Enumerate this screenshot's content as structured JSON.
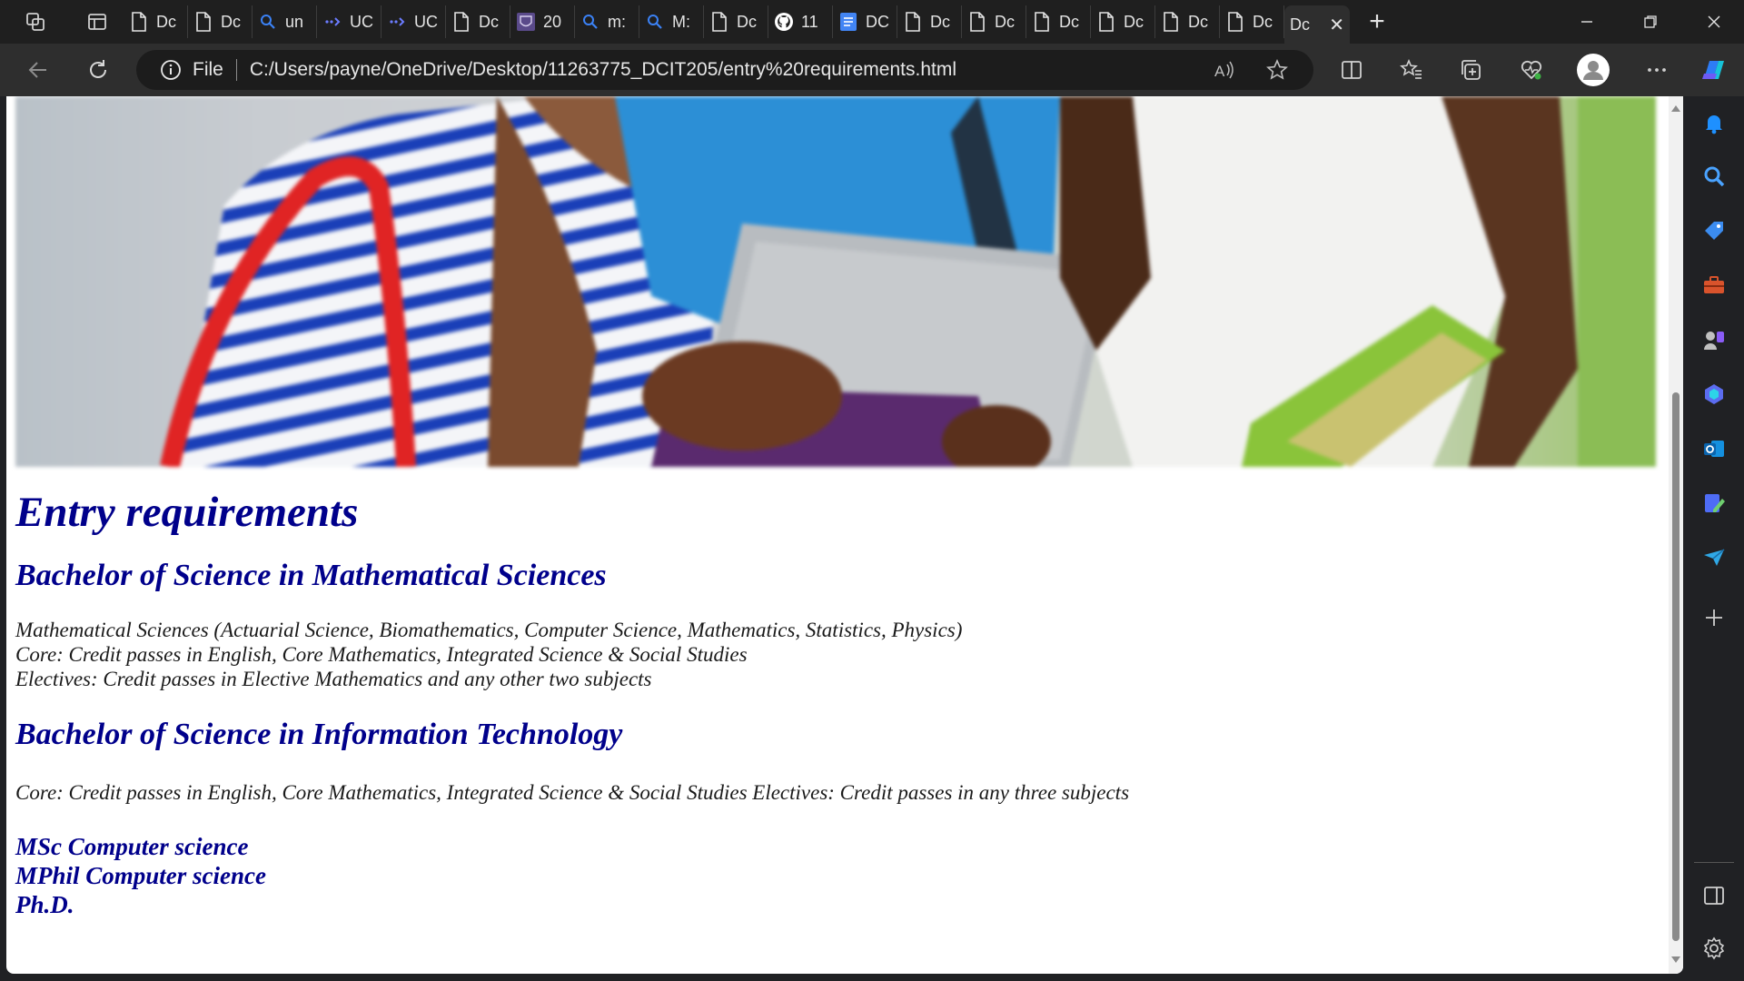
{
  "tabs": [
    {
      "label": "Dc",
      "icon": "document-icon"
    },
    {
      "label": "Dc",
      "icon": "document-icon"
    },
    {
      "label": "un",
      "icon": "search-icon"
    },
    {
      "label": "UC",
      "icon": "arrow-link-icon"
    },
    {
      "label": "UC",
      "icon": "arrow-link-icon"
    },
    {
      "label": "Dc",
      "icon": "document-icon"
    },
    {
      "label": "20",
      "icon": "crest-icon"
    },
    {
      "label": "m:",
      "icon": "search-icon"
    },
    {
      "label": "M:",
      "icon": "search-icon"
    },
    {
      "label": "Dc",
      "icon": "document-icon"
    },
    {
      "label": "11",
      "icon": "github-icon"
    },
    {
      "label": "DC",
      "icon": "docs-icon"
    },
    {
      "label": "Dc",
      "icon": "document-icon"
    },
    {
      "label": "Dc",
      "icon": "document-icon"
    },
    {
      "label": "Dc",
      "icon": "document-icon"
    },
    {
      "label": "Dc",
      "icon": "document-icon"
    },
    {
      "label": "Dc",
      "icon": "document-icon"
    },
    {
      "label": "Dc",
      "icon": "document-icon"
    }
  ],
  "active_tab": {
    "label": "Dc"
  },
  "address_bar": {
    "scheme_label": "File",
    "url": "C:/Users/payne/OneDrive/Desktop/11263775_DCIT205/entry%20requirements.html"
  },
  "page": {
    "title": "Entry requirements",
    "programs": [
      {
        "heading": "Bachelor of Science in Mathematical Sciences",
        "lines": [
          "Mathematical Sciences (Actuarial Science, Biomathematics, Computer Science, Mathematics, Statistics, Physics)",
          "Core: Credit passes in English, Core Mathematics, Integrated Science & Social Studies",
          "Electives: Credit passes in Elective Mathematics and any other two subjects"
        ]
      },
      {
        "heading": "Bachelor of Science in Information Technology",
        "lines": [
          "Core: Credit passes in English, Core Mathematics, Integrated Science & Social Studies Electives: Credit passes in any three subjects"
        ]
      }
    ],
    "postgraduate": [
      "MSc Computer science",
      "MPhil Computer science",
      "Ph.D."
    ]
  },
  "colors": {
    "heading": "#00008b",
    "browser_frame": "#202124",
    "toolbar": "#2e2e2e"
  },
  "sidebar_icons": [
    "bell-icon",
    "search-icon",
    "tag-icon",
    "briefcase-icon",
    "games-icon",
    "bing-icon",
    "outlook-icon",
    "edit-icon",
    "send-icon",
    "add-icon",
    "sidebar-toggle-icon",
    "settings-icon"
  ]
}
